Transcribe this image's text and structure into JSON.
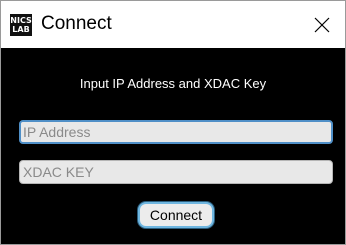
{
  "window": {
    "title": "Connect",
    "icon": {
      "name": "nics-lab-logo",
      "line1": "NICS",
      "line2": "LAB"
    }
  },
  "dialog": {
    "prompt": "Input IP Address and XDAC Key",
    "ip_field": {
      "value": "",
      "placeholder": "IP Address"
    },
    "key_field": {
      "value": "",
      "placeholder": "XDAC KEY"
    },
    "connect_label": "Connect"
  },
  "colors": {
    "background": "#000000",
    "focus_border": "#4f8fc7",
    "button_border": "#6fb6e0"
  }
}
